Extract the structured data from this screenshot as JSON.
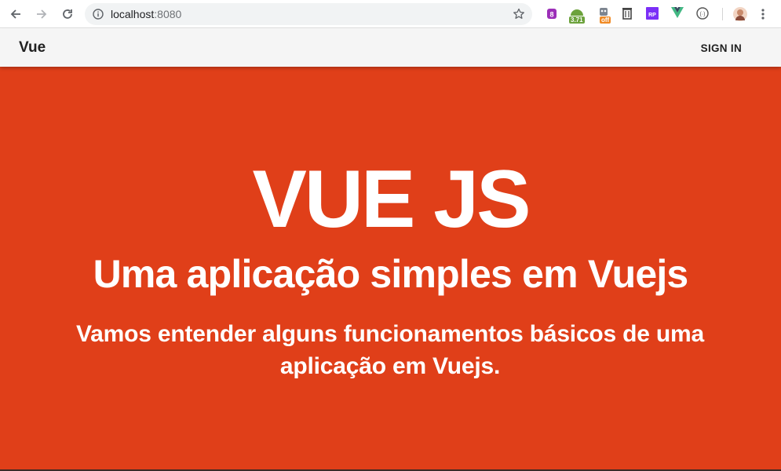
{
  "browser": {
    "url_host": "localhost",
    "url_port": ":8080",
    "extensions": [
      {
        "icon": "extension-purple-icon"
      },
      {
        "icon": "extension-android-icon",
        "badge": "3.71"
      },
      {
        "icon": "extension-robot-icon",
        "badge": "off"
      },
      {
        "icon": "trash-icon"
      },
      {
        "icon": "extension-rp-icon",
        "label": "RP"
      },
      {
        "icon": "vue-devtools-icon"
      },
      {
        "icon": "extension-circle-icon"
      },
      {
        "icon": "profile-avatar-icon"
      }
    ],
    "colors": {
      "badge_green": "#6ca23c",
      "badge_orange": "#f08a24",
      "vue_green": "#42b883",
      "rp_purple": "#7b2ff7"
    }
  },
  "appbar": {
    "title": "Vue",
    "signin_label": "SIGN IN"
  },
  "hero": {
    "headline": "VUE JS",
    "subheading": "Uma aplicação simples em Vuejs",
    "description": "Vamos entender alguns funcionamentos básicos de uma aplicação em Vuejs.",
    "background": "#e03f19"
  }
}
